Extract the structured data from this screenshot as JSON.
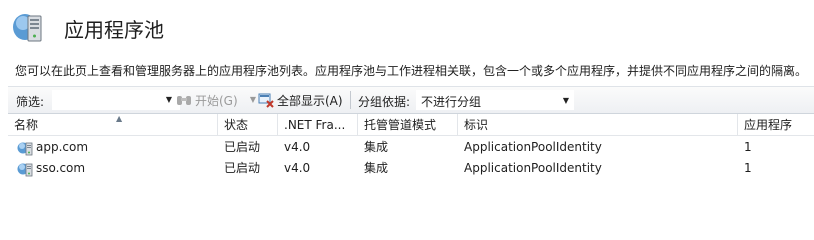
{
  "header": {
    "title": "应用程序池",
    "icon": "server-pool-icon"
  },
  "description": "您可以在此页上查看和管理服务器上的应用程序池列表。应用程序池与工作进程相关联，包含一个或多个应用程序，并提供不同应用程序之间的隔离。",
  "toolbar": {
    "filter_label": "筛选:",
    "filter_value": "",
    "start_label": "开始(G)",
    "show_all_label": "全部显示(A)",
    "group_by_label": "分组依据:",
    "group_by_value": "不进行分组"
  },
  "table": {
    "columns": [
      "名称",
      "状态",
      ".NET Fra...",
      "托管管道模式",
      "标识",
      "应用程序"
    ],
    "rows": [
      {
        "name": "app.com",
        "status": "已启动",
        "net": "v4.0",
        "pipeline": "集成",
        "identity": "ApplicationPoolIdentity",
        "apps": "1"
      },
      {
        "name": "sso.com",
        "status": "已启动",
        "net": "v4.0",
        "pipeline": "集成",
        "identity": "ApplicationPoolIdentity",
        "apps": "1"
      }
    ]
  },
  "colors": {
    "toolbar_bg": "#eef0f3",
    "grid_line": "#e3e6ea",
    "disabled_text": "#9a9a9a"
  }
}
